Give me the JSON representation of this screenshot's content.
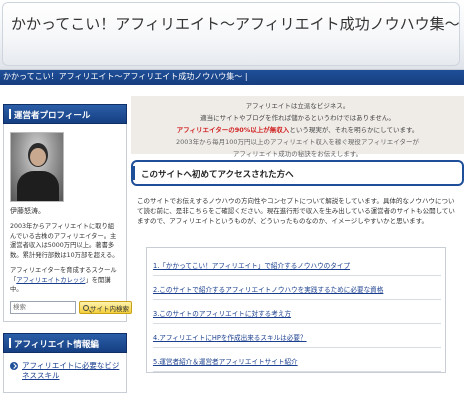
{
  "header": {
    "site_title": "かかってこい！アフィリエイト〜アフィリエイト成功ノウハウ集〜",
    "breadcrumb": "かかってこい！アフィリエイト〜アフィリエイト成功ノウハウ集〜 |"
  },
  "sidebar": {
    "profile_heading": "運営者プロフィール",
    "profile_name": "伊藤怒涛。",
    "profile_text": "2003年からアフィリエイトに取り組んでいる古株のアフィリエイター。主運営者収入は5000万円以上。著書多数。累計発行部数は10万部を超える。",
    "profile_text2_before": "アフィリエイターを育成するスクール「",
    "profile_link": "アフィリエイトカレッジ",
    "profile_text2_after": "」を開講中。",
    "search_placeholder": "検索",
    "search_button_label": "サイト内検索",
    "info_heading": "アフィリエイト情報編",
    "info_items": [
      "アフィリエイトに必要なビジネススキル"
    ]
  },
  "intro": {
    "line1": "アフィリエイトは立派なビジネス。",
    "line2": "適当にサイトやブログを作れば儲かるというわけではありません。",
    "line3_red": "アフィリエイターの90%以上が無収入",
    "line3_rest": "という現実が、それを明らかにしています。",
    "line4": "2003年から毎月100万円以上のアフィリエイト収入を稼ぐ現役アフィリエイターが",
    "line5": "アフィリエイト成功の秘訣をお伝えします。"
  },
  "section": {
    "title": "このサイトへ初めてアクセスされた方へ",
    "text": "このサイトでお伝えするノウハウの方向性やコンセプトについて解説をしています。具体的なノウハウについて読む前に、是非こちらをご確認ください。現在進行形で収入を生み出している運営者のサイトも公開していますので、アフィリエイトというものが、どういったものなのか、イメージしやすいかと思います。"
  },
  "toc": [
    "1.「かかってこい！アフィリエイト」で紹介するノウハウのタイプ",
    "2.このサイトで紹介するアフィリエイトノウハウを実践するために必要な資格",
    "3.このサイトのアフィリエイトに対する考え方",
    "4.アフィリエイトにHPを作成出来るスキルは必要？",
    "5.運営者紹介＆運営者アフィリエイトサイト紹介"
  ]
}
